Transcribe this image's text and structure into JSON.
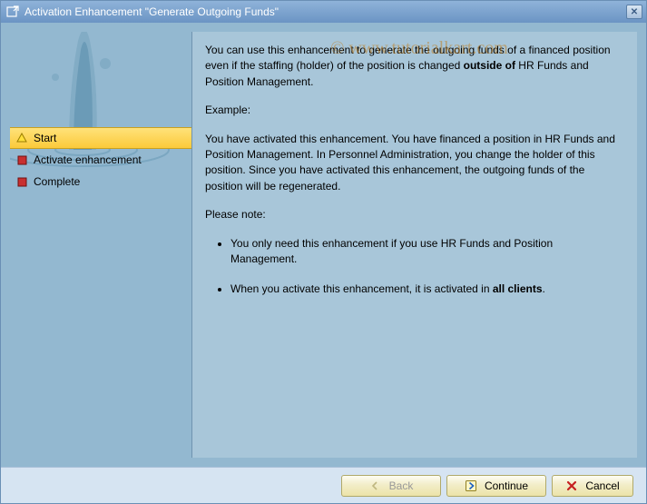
{
  "window": {
    "title": "Activation Enhancement \"Generate Outgoing Funds\""
  },
  "watermark": "© www.tutorialkart.com",
  "sidebar": {
    "items": [
      {
        "label": "Start",
        "active": true
      },
      {
        "label": "Activate enhancement",
        "active": false
      },
      {
        "label": "Complete",
        "active": false
      }
    ]
  },
  "main": {
    "intro_pre": "You can use this enhancement to generate the outgoing funds of a financed position even if the staffing (holder) of the position is changed ",
    "intro_bold": "outside of",
    "intro_post": " HR Funds and Position Management.",
    "example_label": "Example:",
    "example_text": "You have activated this enhancement. You have financed a position in HR Funds and Position Management. In Personnel Administration, you change the holder of this position. Since you have activated this enhancement, the outgoing funds of the position will be regenerated.",
    "note_label": "Please note:",
    "notes": {
      "n1": "You only need this enhancement if you use HR Funds and Position Management.",
      "n2_pre": "When you activate this enhancement, it is activated in ",
      "n2_bold": "all clients",
      "n2_post": "."
    }
  },
  "buttons": {
    "back": "Back",
    "continue": "Continue",
    "cancel": "Cancel"
  }
}
